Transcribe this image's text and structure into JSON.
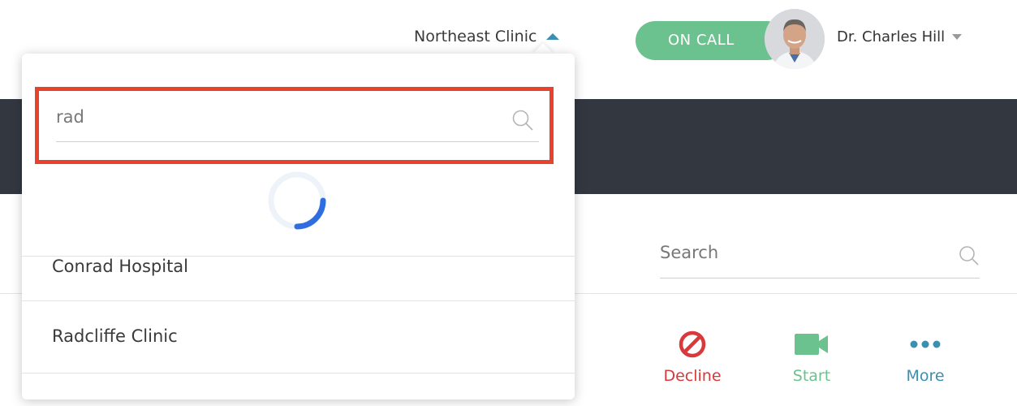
{
  "header": {
    "clinic_name": "Northeast Clinic",
    "on_call_label": "ON CALL",
    "user_name": "Dr. Charles Hill"
  },
  "right_panel": {
    "search_placeholder": "Search",
    "actions": [
      {
        "label": "Decline",
        "icon": "decline-icon",
        "color": "#d9393b"
      },
      {
        "label": "Start",
        "icon": "video-camera-icon",
        "color": "#6cc28f"
      },
      {
        "label": "More",
        "icon": "more-dots-icon",
        "color": "#3b8fb0"
      }
    ]
  },
  "dropdown": {
    "search_value": "rad",
    "loading": true,
    "results": [
      "Conrad Hospital",
      "Radcliffe Clinic"
    ]
  },
  "colors": {
    "accent_green": "#6cc28f",
    "dark_band": "#333840",
    "highlight_red": "#e8412c",
    "spinner_blue": "#2f6ee0"
  }
}
